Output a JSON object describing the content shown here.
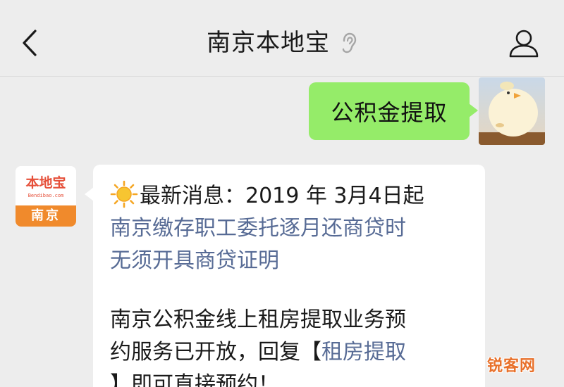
{
  "header": {
    "title": "南京本地宝",
    "back_icon": "chevron-left-icon",
    "mute_icon": "mute-ear-icon",
    "profile_icon": "person-icon"
  },
  "messages": {
    "outgoing": {
      "text": "公积金提取",
      "bubble_color": "#95ec69"
    },
    "incoming": {
      "avatar": {
        "logo_text": "本地宝",
        "logo_sub": "Bendibao.com",
        "city": "南京"
      },
      "line1_prefix": "最新消息：2019 年 3月4日起",
      "link_line1": "南京缴存职工委托逐月还商贷时",
      "link_line2": "无须开具商贷证明",
      "para2_line1": "南京公积金线上租房提取业务预",
      "para2_line2_prefix": "约服务已开放，回复【",
      "para2_link": "租房提取",
      "para2_line3": "】即可直接预约！",
      "link_color": "#576b95"
    }
  },
  "watermark": {
    "text": "锐客网"
  }
}
